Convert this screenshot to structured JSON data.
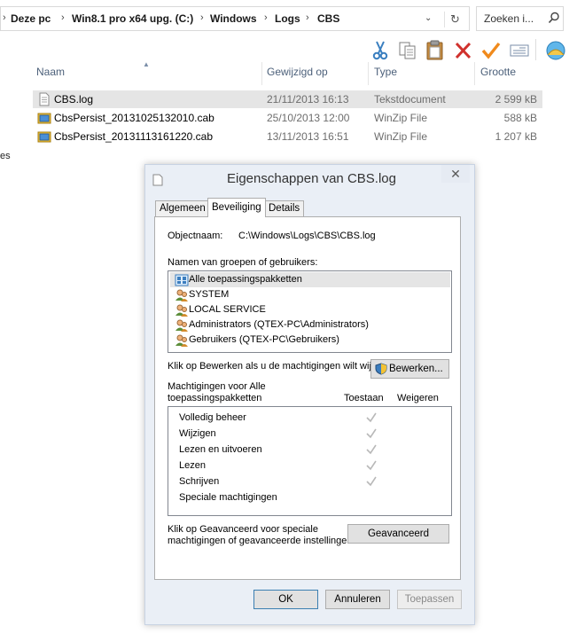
{
  "explorer": {
    "breadcrumbs": [
      "Deze pc",
      "Win8.1 pro x64 upg. (C:)",
      "Windows",
      "Logs",
      "CBS"
    ],
    "search_placeholder": "Zoeken i...",
    "columns": {
      "name": "Naam",
      "modified": "Gewijzigd op",
      "type": "Type",
      "size": "Grootte"
    },
    "files": [
      {
        "name": "CBS.log",
        "modified": "21/11/2013 16:13",
        "type": "Tekstdocument",
        "size": "2 599 kB",
        "icon": "text-file-icon",
        "selected": true
      },
      {
        "name": "CbsPersist_20131025132010.cab",
        "modified": "25/10/2013 12:00",
        "type": "WinZip File",
        "size": "588 kB",
        "icon": "cab-archive-icon",
        "selected": false
      },
      {
        "name": "CbsPersist_20131113161220.cab",
        "modified": "13/11/2013 16:51",
        "type": "WinZip File",
        "size": "1 207 kB",
        "icon": "cab-archive-icon",
        "selected": false
      }
    ],
    "left_pane_fragment": "es",
    "toolbar_icons": [
      "cut-icon",
      "copy-icon",
      "paste-icon",
      "delete-icon",
      "check-icon",
      "rename-icon",
      "shell-icon"
    ]
  },
  "dialog": {
    "title": "Eigenschappen van CBS.log",
    "close_glyph": "✕",
    "tabs": [
      {
        "label": "Algemeen",
        "active": false
      },
      {
        "label": "Beveiliging",
        "active": true
      },
      {
        "label": "Details",
        "active": false
      }
    ],
    "object_label": "Objectnaam:",
    "object_value": "C:\\Windows\\Logs\\CBS\\CBS.log",
    "groups_label": "Namen van groepen of gebruikers:",
    "groups": [
      {
        "name": "Alle toepassingspakketten",
        "icon": "app-packages-icon",
        "selected": true
      },
      {
        "name": "SYSTEM",
        "icon": "users-icon",
        "selected": false
      },
      {
        "name": "LOCAL SERVICE",
        "icon": "users-icon",
        "selected": false
      },
      {
        "name": "Administrators (QTEX-PC\\Administrators)",
        "icon": "users-icon",
        "selected": false
      },
      {
        "name": "Gebruikers (QTEX-PC\\Gebruikers)",
        "icon": "users-icon",
        "selected": false
      }
    ],
    "edit_hint": "Klik op Bewerken als u de machtigingen wilt wijzi",
    "edit_button": "Bewerken...",
    "permissions_label_line1": "Machtigingen voor Alle",
    "permissions_label_line2": "toepassingspakketten",
    "allow_header": "Toestaan",
    "deny_header": "Weigeren",
    "permissions": [
      {
        "name": "Volledig beheer",
        "allow": true,
        "deny": false
      },
      {
        "name": "Wijzigen",
        "allow": true,
        "deny": false
      },
      {
        "name": "Lezen en uitvoeren",
        "allow": true,
        "deny": false
      },
      {
        "name": "Lezen",
        "allow": true,
        "deny": false
      },
      {
        "name": "Schrijven",
        "allow": true,
        "deny": false
      },
      {
        "name": "Speciale machtigingen",
        "allow": false,
        "deny": false
      }
    ],
    "advanced_hint_line1": "Klik op Geavanceerd voor speciale",
    "advanced_hint_line2": "machtigingen of geavanceerde instellingen.",
    "advanced_button": "Geavanceerd",
    "ok_button": "OK",
    "cancel_button": "Annuleren",
    "apply_button": "Toepassen"
  }
}
